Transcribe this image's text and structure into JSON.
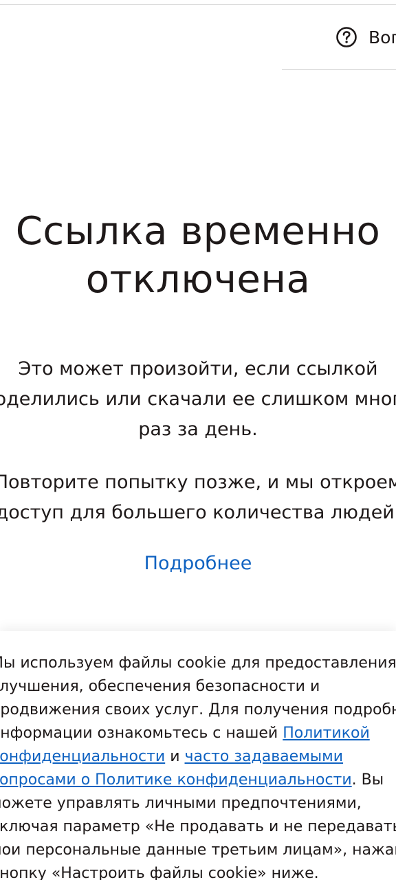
{
  "header": {
    "help_label": "Вопросы?"
  },
  "main": {
    "title_line1": "Ссылка временно",
    "title_line2": "отключена",
    "message1": {
      "line1": "Это может произойти, если ссылкой",
      "line2": "поделились или скачали ее слишком много",
      "line3": "раз за день."
    },
    "message2": {
      "line1": "Повторите попытку позже, и мы откроем",
      "line2": "доступ для большего количества людей."
    },
    "learn_more_label": "Подробнее"
  },
  "cookie_banner": {
    "line1": "Мы используем файлы cookie для предоставления,",
    "line2": "улучшения, обеспечения безопасности и",
    "line3": "продвижения своих услуг. Для получения подробной",
    "line4_text": "информации ознакомьтесь с нашей ",
    "privacy_policy_link_1": "Политикой",
    "privacy_policy_link_2": "конфиденциальности",
    "and_text": " и ",
    "faq_link_1": "часто задаваемыми",
    "faq_link_2": "вопросами о Политике конфиденциальности",
    "line7_after": ". Вы",
    "line8": "можете управлять личными предпочтениями,",
    "line9": "включая параметр «Не продавать и не передавать",
    "line10": "мои персональные данные третьим лицам», нажав",
    "line11": "кнопку «Настроить файлы cookie» ниже."
  }
}
